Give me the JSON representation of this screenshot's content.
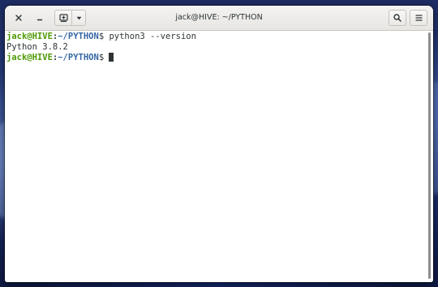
{
  "window": {
    "title": "jack@HIVE: ~/PYTHON",
    "buttons": {
      "close_icon": "close-icon",
      "minimize_icon": "minimize-icon",
      "new_tab_icon": "new-tab-icon",
      "menu_dropdown_icon": "chevron-down-icon",
      "search_icon": "search-icon",
      "hamburger_icon": "hamburger-menu-icon"
    }
  },
  "terminal": {
    "lines": [
      {
        "user": "jack@HIVE",
        "sep": ":",
        "path": "~/PYTHON",
        "symbol": "$",
        "command": " python3 --version"
      },
      {
        "output": "Python 3.8.2"
      },
      {
        "user": "jack@HIVE",
        "sep": ":",
        "path": "~/PYTHON",
        "symbol": "$",
        "command": " "
      }
    ]
  },
  "colors": {
    "prompt_user": "#4e9a06",
    "prompt_path": "#3465a4",
    "text": "#2e3436",
    "background": "#ffffff"
  }
}
